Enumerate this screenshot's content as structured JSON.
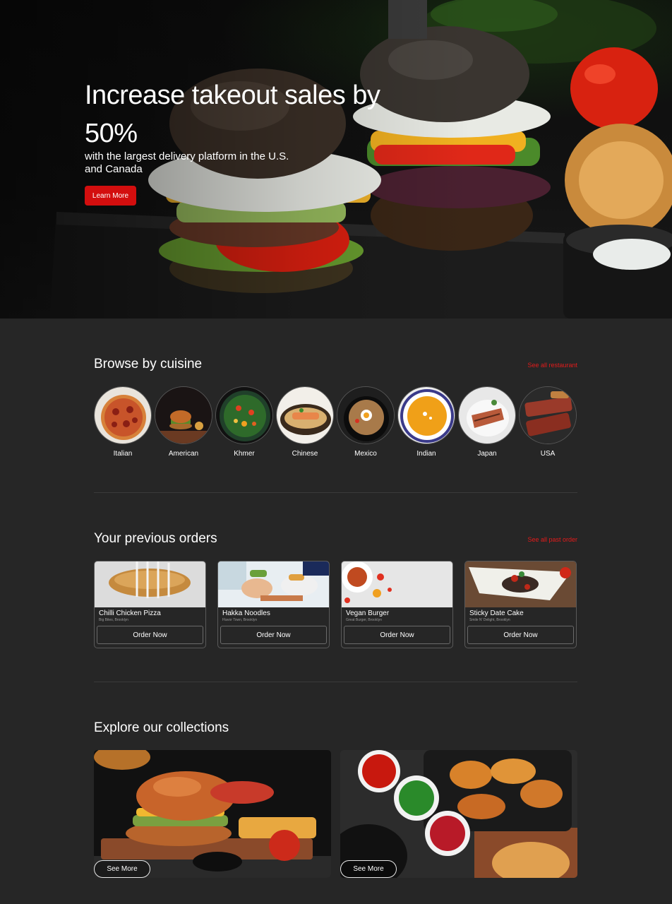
{
  "hero": {
    "title": "Increase takeout sales by 50%",
    "subtitle": "with the largest delivery platform in the U.S. and Canada",
    "cta_label": "Learn More",
    "accent_color": "#d30e0e"
  },
  "cuisine_section": {
    "title": "Browse by cuisine",
    "link_label": "See all restaurant",
    "items": [
      {
        "label": "Italian",
        "icon": "pizza-image"
      },
      {
        "label": "American",
        "icon": "burger-image"
      },
      {
        "label": "Khmer",
        "icon": "salad-image"
      },
      {
        "label": "Chinese",
        "icon": "fish-dish-image"
      },
      {
        "label": "Mexico",
        "icon": "noodle-bowl-image"
      },
      {
        "label": "Indian",
        "icon": "soup-image"
      },
      {
        "label": "Japan",
        "icon": "grilled-dish-image"
      },
      {
        "label": "USA",
        "icon": "ribs-image"
      }
    ]
  },
  "orders_section": {
    "title": "Your previous orders",
    "link_label": "See all past order",
    "button_label": "Order Now",
    "items": [
      {
        "name": "Chilli Chicken Pizza",
        "location": "Big Bites, Brooklyn"
      },
      {
        "name": "Hakka Noodles",
        "location": "Flavor Town, Brooklyn"
      },
      {
        "name": "Vegan Burger",
        "location": "Great Burger, Brooklyn"
      },
      {
        "name": "Sticky Date Cake",
        "location": "Smile N' Delight, Brooklyn"
      }
    ]
  },
  "collections_section": {
    "title": "Explore our collections",
    "button_label": "See More",
    "items": [
      {
        "icon": "burger-fries-image"
      },
      {
        "icon": "grilled-chicken-spread-image"
      }
    ]
  },
  "colors": {
    "background": "#262626",
    "link": "#e31b1b",
    "text": "#ffffff"
  }
}
